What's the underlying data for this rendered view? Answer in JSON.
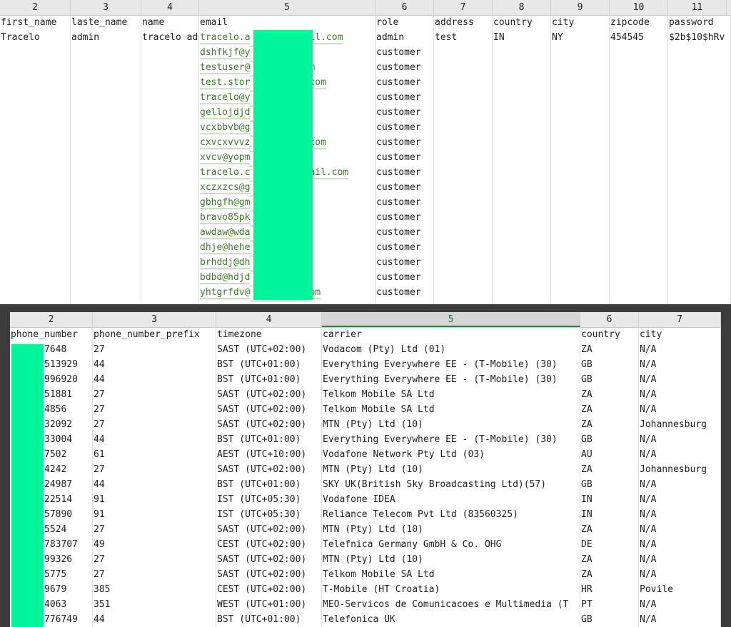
{
  "top_table": {
    "column_numbers": [
      "2",
      "3",
      "4",
      "5",
      "6",
      "7",
      "8",
      "9",
      "10",
      "11"
    ],
    "headers": {
      "first_name": "first_name",
      "last_name": "laste_name",
      "name": "name",
      "email": "email",
      "role": "role",
      "address": "address",
      "country": "country",
      "city": "city",
      "zipcode": "zipcode",
      "password": "password"
    },
    "first_row": {
      "first_name": "Tracelo",
      "last_name": "admin",
      "name": "tracelo ad",
      "address": "test",
      "country": "IN",
      "city": "NY",
      "zipcode": "454545",
      "password": "$2b$10$hRv"
    },
    "emails": [
      {
        "visible": "tracelo.a",
        "tail": "il.com"
      },
      {
        "visible": "dshfkjf@y",
        "tail": ""
      },
      {
        "visible": "testuser@",
        "tail": "m"
      },
      {
        "visible": "test.stor",
        "tail": "com"
      },
      {
        "visible": "tracelo@y",
        "tail": ""
      },
      {
        "visible": "gellojdjd",
        "tail": ""
      },
      {
        "visible": "vcxbbvb@g",
        "tail": ""
      },
      {
        "visible": "cxvcxvvvz",
        "tail": "com"
      },
      {
        "visible": "xvcv@yopm",
        "tail": ""
      },
      {
        "visible": "tracelo.c",
        "tail": "ail.com"
      },
      {
        "visible": "xczxzcs@g",
        "tail": ""
      },
      {
        "visible": "gbhgfh@gm",
        "tail": ""
      },
      {
        "visible": "bravo85pk",
        "tail": ""
      },
      {
        "visible": "awdaw@wda",
        "tail": ""
      },
      {
        "visible": "dhje@hehe",
        "tail": ""
      },
      {
        "visible": "brhddj@dh",
        "tail": ""
      },
      {
        "visible": "bdbd@hdjd",
        "tail": ""
      },
      {
        "visible": "yhtgrfdv@",
        "tail": "om"
      }
    ],
    "roles": [
      "admin",
      "customer",
      "customer",
      "customer",
      "customer",
      "customer",
      "customer",
      "customer",
      "customer",
      "customer",
      "customer",
      "customer",
      "customer",
      "customer",
      "customer",
      "customer",
      "customer",
      "customer"
    ],
    "redaction_color": "#00f59a"
  },
  "bottom_table": {
    "column_numbers": [
      "2",
      "3",
      "4",
      "5",
      "6",
      "7"
    ],
    "selected_column": "5",
    "headers": {
      "phone_number": "phone_number",
      "phone_number_prefix": "phone_number_prefix",
      "timezone": "timezone",
      "carrier": "carrier",
      "country": "country",
      "city": "city"
    },
    "rows": [
      {
        "phone": "7648",
        "prefix": "27",
        "tz": "SAST (UTC+02:00)",
        "carrier": "Vodacom (Pty) Ltd (01)",
        "country": "ZA",
        "city": "N/A"
      },
      {
        "phone": "513929",
        "prefix": "44",
        "tz": "BST (UTC+01:00)",
        "carrier": "Everything Everywhere EE - (T-Mobile) (30)",
        "country": "GB",
        "city": "N/A"
      },
      {
        "phone": "996920",
        "prefix": "44",
        "tz": "BST (UTC+01:00)",
        "carrier": "Everything Everywhere EE - (T-Mobile) (30)",
        "country": "GB",
        "city": "N/A"
      },
      {
        "phone": "51881",
        "prefix": "27",
        "tz": "SAST (UTC+02:00)",
        "carrier": "Telkom Mobile SA Ltd",
        "country": "ZA",
        "city": "N/A"
      },
      {
        "phone": "4856",
        "prefix": "27",
        "tz": "SAST (UTC+02:00)",
        "carrier": "Telkom Mobile SA Ltd",
        "country": "ZA",
        "city": "N/A"
      },
      {
        "phone": "32092",
        "prefix": "27",
        "tz": "SAST (UTC+02:00)",
        "carrier": "MTN (Pty) Ltd (10)",
        "country": "ZA",
        "city": "Johannesburg"
      },
      {
        "phone": "33004",
        "prefix": "44",
        "tz": "BST (UTC+01:00)",
        "carrier": "Everything Everywhere EE - (T-Mobile) (30)",
        "country": "GB",
        "city": "N/A"
      },
      {
        "phone": "7502",
        "prefix": "61",
        "tz": "AEST (UTC+10:00)",
        "carrier": "Vodafone Network Pty Ltd (03)",
        "country": "AU",
        "city": "N/A"
      },
      {
        "phone": "4242",
        "prefix": "27",
        "tz": "SAST (UTC+02:00)",
        "carrier": "MTN (Pty) Ltd (10)",
        "country": "ZA",
        "city": "Johannesburg"
      },
      {
        "phone": "24987",
        "prefix": "44",
        "tz": "BST (UTC+01:00)",
        "carrier": "SKY UK(British Sky Broadcasting Ltd)(57)",
        "country": "GB",
        "city": "N/A"
      },
      {
        "phone": "22514",
        "prefix": "91",
        "tz": "IST (UTC+05:30)",
        "carrier": "Vodafone IDEA",
        "country": "IN",
        "city": "N/A"
      },
      {
        "phone": "57890",
        "prefix": "91",
        "tz": "IST (UTC+05:30)",
        "carrier": "Reliance Telecom Pvt Ltd (83560325)",
        "country": "IN",
        "city": "N/A"
      },
      {
        "phone": "5524",
        "prefix": "27",
        "tz": "SAST (UTC+02:00)",
        "carrier": "MTN (Pty) Ltd (10)",
        "country": "ZA",
        "city": "N/A"
      },
      {
        "phone": "783707",
        "prefix": "49",
        "tz": "CEST (UTC+02:00)",
        "carrier": "Telefnica Germany GmbH & Co. OHG",
        "country": "DE",
        "city": "N/A"
      },
      {
        "phone": "99326",
        "prefix": "27",
        "tz": "SAST (UTC+02:00)",
        "carrier": "MTN (Pty) Ltd (10)",
        "country": "ZA",
        "city": "N/A"
      },
      {
        "phone": "5775",
        "prefix": "27",
        "tz": "SAST (UTC+02:00)",
        "carrier": "Telkom Mobile SA Ltd",
        "country": "ZA",
        "city": "N/A"
      },
      {
        "phone": "9679",
        "prefix": "385",
        "tz": "CEST (UTC+02:00)",
        "carrier": "T-Mobile (HT Croatia)",
        "country": "HR",
        "city": "Povile"
      },
      {
        "phone": "4063",
        "prefix": "351",
        "tz": "WEST (UTC+01:00)",
        "carrier": "MEO-Servicos de Comunicacoes e Multimedia (T",
        "country": "PT",
        "city": "N/A"
      },
      {
        "phone": "776749",
        "prefix": "44",
        "tz": "BST (UTC+01:00)",
        "carrier": "Telefonica UK",
        "country": "GB",
        "city": "N/A"
      }
    ],
    "accent_color": "#2e7d46"
  }
}
